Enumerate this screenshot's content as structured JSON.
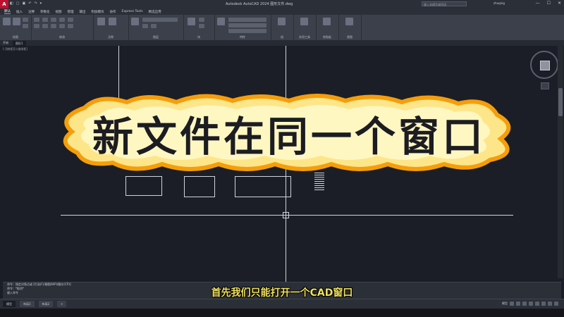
{
  "titlebar": {
    "logo": "A",
    "title": "Autodesk AutoCAD 2024  图形文件.dwg",
    "search_placeholder": "键入关键字或短语",
    "user": "zhuqing",
    "window_buttons": [
      "—",
      "☐",
      "✕"
    ]
  },
  "qat": [
    "◧",
    "▢",
    "▣",
    "↶",
    "↷",
    "▾"
  ],
  "tabs": [
    "默认",
    "插入",
    "注释",
    "参数化",
    "视图",
    "管理",
    "输出",
    "附加模块",
    "协作",
    "Express Tools",
    "精选应用"
  ],
  "active_tab": "默认",
  "ribbon_panels": [
    "绘图",
    "修改",
    "注释",
    "图层",
    "块",
    "特性",
    "组",
    "实用工具",
    "剪贴板",
    "视图"
  ],
  "doc_tabs": [
    "开始",
    "图形1"
  ],
  "viewport_label": "[-][俯视][二维线框]",
  "banner": {
    "text": "新文件在同一个窗口"
  },
  "command": {
    "lines": [
      "命令：指定对角点或 [栏选(F)/圈围(WP)/圈交(CP)]:",
      "命令：*取消*"
    ],
    "input_placeholder": "键入命令"
  },
  "subtitle": "首先我们只能打开一个CAD窗口",
  "layout_tabs": [
    "模型",
    "布局1",
    "布局2",
    "+"
  ],
  "status": {
    "label": "模型"
  },
  "colors": {
    "banner_fill": "#fde68a",
    "banner_stroke": "#f59e0b",
    "subtitle": "#f0e060",
    "canvas": "#1b1e26",
    "ui_dark": "#2b2f38"
  }
}
